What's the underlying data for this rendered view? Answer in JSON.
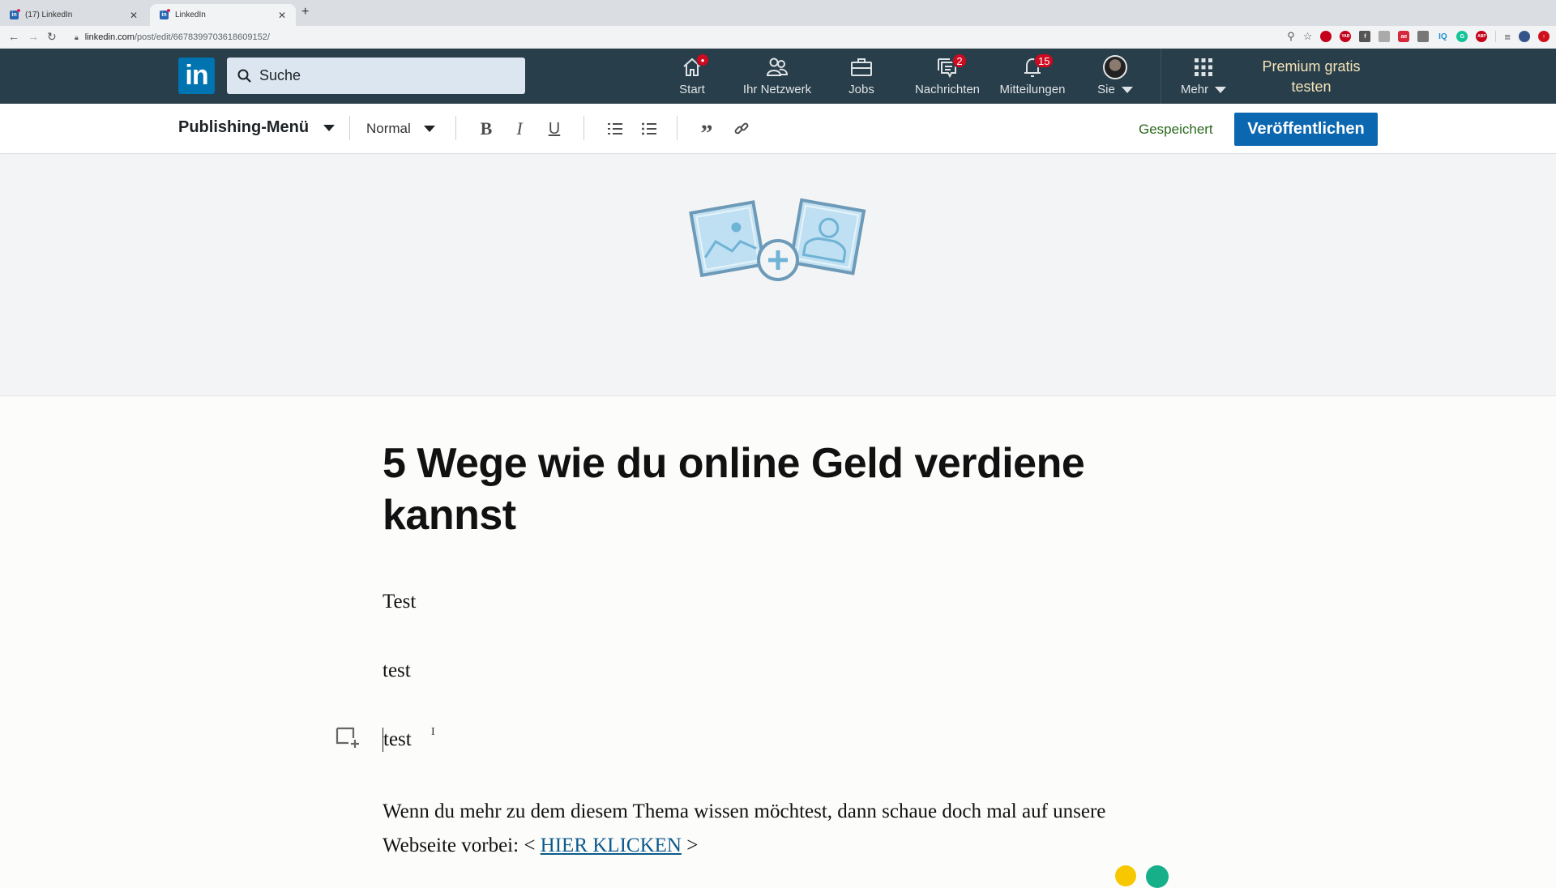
{
  "browser": {
    "tabs": [
      {
        "label": "(17) LinkedIn",
        "active": false
      },
      {
        "label": "LinkedIn",
        "active": true
      }
    ],
    "new_tab_icon": "plus-icon",
    "url_host": "linkedin.com",
    "url_path": "/post/edit/6678399703618609152/",
    "extensions": [
      {
        "name": "ublock",
        "color": "#c4001a",
        "text": ""
      },
      {
        "name": "yab",
        "color": "#c4001a",
        "text": "YAB"
      },
      {
        "name": "facebook",
        "color": "#555",
        "text": "f"
      },
      {
        "name": "ext-grey",
        "color": "#aaa",
        "text": "K"
      },
      {
        "name": "ae",
        "color": "#d6283a",
        "text": "ae"
      },
      {
        "name": "ext-box",
        "color": "#777",
        "text": "▢"
      },
      {
        "name": "iq",
        "color": "#1a8cd8",
        "text": "IQ"
      },
      {
        "name": "grammarly",
        "color": "#15c39a",
        "text": "G"
      },
      {
        "name": "adblock",
        "color": "#c4001a",
        "text": "ABP"
      },
      {
        "name": "media",
        "color": "#555",
        "text": "≡"
      },
      {
        "name": "profile",
        "color": "#34548a",
        "text": ""
      },
      {
        "name": "update",
        "color": "#d0101a",
        "text": "↑"
      }
    ]
  },
  "nav": {
    "search_placeholder": "Suche",
    "items": [
      {
        "label": "Start",
        "icon": "home-icon",
        "badge": "•"
      },
      {
        "label": "Ihr Netzwerk",
        "icon": "network-icon",
        "badge": ""
      },
      {
        "label": "Jobs",
        "icon": "briefcase-icon",
        "badge": ""
      },
      {
        "label": "Nachrichten",
        "icon": "messages-icon",
        "badge": "2"
      },
      {
        "label": "Mitteilungen",
        "icon": "bell-icon",
        "badge": "15"
      },
      {
        "label": "Sie",
        "icon": "avatar",
        "badge": ""
      },
      {
        "label": "Mehr",
        "icon": "grid-icon",
        "badge": ""
      }
    ],
    "premium": "Premium gratis testen"
  },
  "editor_toolbar": {
    "publishing_menu": "Publishing-Menü",
    "style_select": "Normal",
    "saved_status": "Gespeichert",
    "publish_button": "Veröffentlichen",
    "format_buttons": [
      "bold",
      "italic",
      "underline",
      "numbered-list",
      "bulleted-list",
      "quote",
      "link"
    ]
  },
  "article": {
    "title": "5 Wege wie du online Geld verdiene kannst",
    "paragraphs": [
      "Test",
      "test",
      "test"
    ],
    "closing_text": "Wenn du mehr zu dem diesem Thema wissen möchtest, dann schaue doch mal auf unsere",
    "closing_text_2": "Webseite vorbei: <",
    "link_text": "HIER KLICKEN",
    "closing_after": ">"
  },
  "colors": {
    "linkedin_blue": "#0073b1",
    "nav_bg": "#283e4a",
    "publish_btn": "#0b67b0",
    "saved_green": "#2b6a1c",
    "badge_red": "#cf0920"
  }
}
